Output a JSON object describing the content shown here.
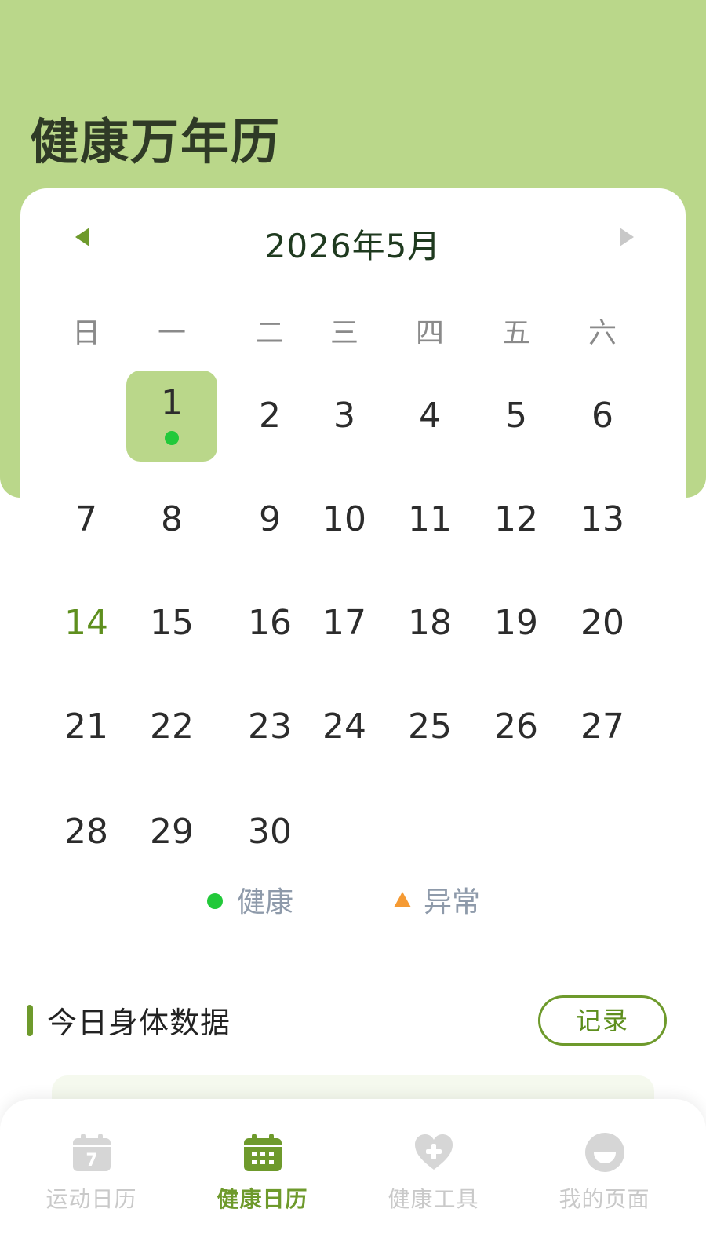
{
  "app": {
    "title": "健康万年历"
  },
  "calendar": {
    "month_label": "2026年5月",
    "weekdays": [
      "日",
      "一",
      "二",
      "三",
      "四",
      "五",
      "六"
    ],
    "days": [
      {
        "num": "1",
        "row": 0,
        "col": 1,
        "selected": true,
        "status": "healthy"
      },
      {
        "num": "2",
        "row": 0,
        "col": 2
      },
      {
        "num": "3",
        "row": 0,
        "col": 3
      },
      {
        "num": "4",
        "row": 0,
        "col": 4
      },
      {
        "num": "5",
        "row": 0,
        "col": 5
      },
      {
        "num": "6",
        "row": 0,
        "col": 6
      },
      {
        "num": "7",
        "row": 1,
        "col": 0
      },
      {
        "num": "8",
        "row": 1,
        "col": 1
      },
      {
        "num": "9",
        "row": 1,
        "col": 2
      },
      {
        "num": "10",
        "row": 1,
        "col": 3
      },
      {
        "num": "11",
        "row": 1,
        "col": 4
      },
      {
        "num": "12",
        "row": 1,
        "col": 5
      },
      {
        "num": "13",
        "row": 1,
        "col": 6
      },
      {
        "num": "14",
        "row": 2,
        "col": 0,
        "highlight": true
      },
      {
        "num": "15",
        "row": 2,
        "col": 1
      },
      {
        "num": "16",
        "row": 2,
        "col": 2
      },
      {
        "num": "17",
        "row": 2,
        "col": 3
      },
      {
        "num": "18",
        "row": 2,
        "col": 4
      },
      {
        "num": "19",
        "row": 2,
        "col": 5
      },
      {
        "num": "20",
        "row": 2,
        "col": 6
      },
      {
        "num": "21",
        "row": 3,
        "col": 0
      },
      {
        "num": "22",
        "row": 3,
        "col": 1
      },
      {
        "num": "23",
        "row": 3,
        "col": 2
      },
      {
        "num": "24",
        "row": 3,
        "col": 3
      },
      {
        "num": "25",
        "row": 3,
        "col": 4
      },
      {
        "num": "26",
        "row": 3,
        "col": 5
      },
      {
        "num": "27",
        "row": 3,
        "col": 6
      },
      {
        "num": "28",
        "row": 4,
        "col": 0
      },
      {
        "num": "29",
        "row": 4,
        "col": 1
      },
      {
        "num": "30",
        "row": 4,
        "col": 2
      }
    ]
  },
  "legend": {
    "healthy": "健康",
    "abnormal": "异常"
  },
  "section": {
    "title": "今日身体数据",
    "record_label": "记录"
  },
  "bottom_nav": [
    {
      "label": "运动日历",
      "icon": "calendar-7-icon",
      "active": false
    },
    {
      "label": "健康日历",
      "icon": "calendar-grid-icon",
      "active": true
    },
    {
      "label": "健康工具",
      "icon": "heart-plus-icon",
      "active": false
    },
    {
      "label": "我的页面",
      "icon": "profile-face-icon",
      "active": false
    }
  ],
  "colors": {
    "header_green": "#bad78a",
    "accent_green": "#6e9a2c",
    "healthy_dot": "#22c93a",
    "abnormal_triangle": "#f59a33"
  }
}
